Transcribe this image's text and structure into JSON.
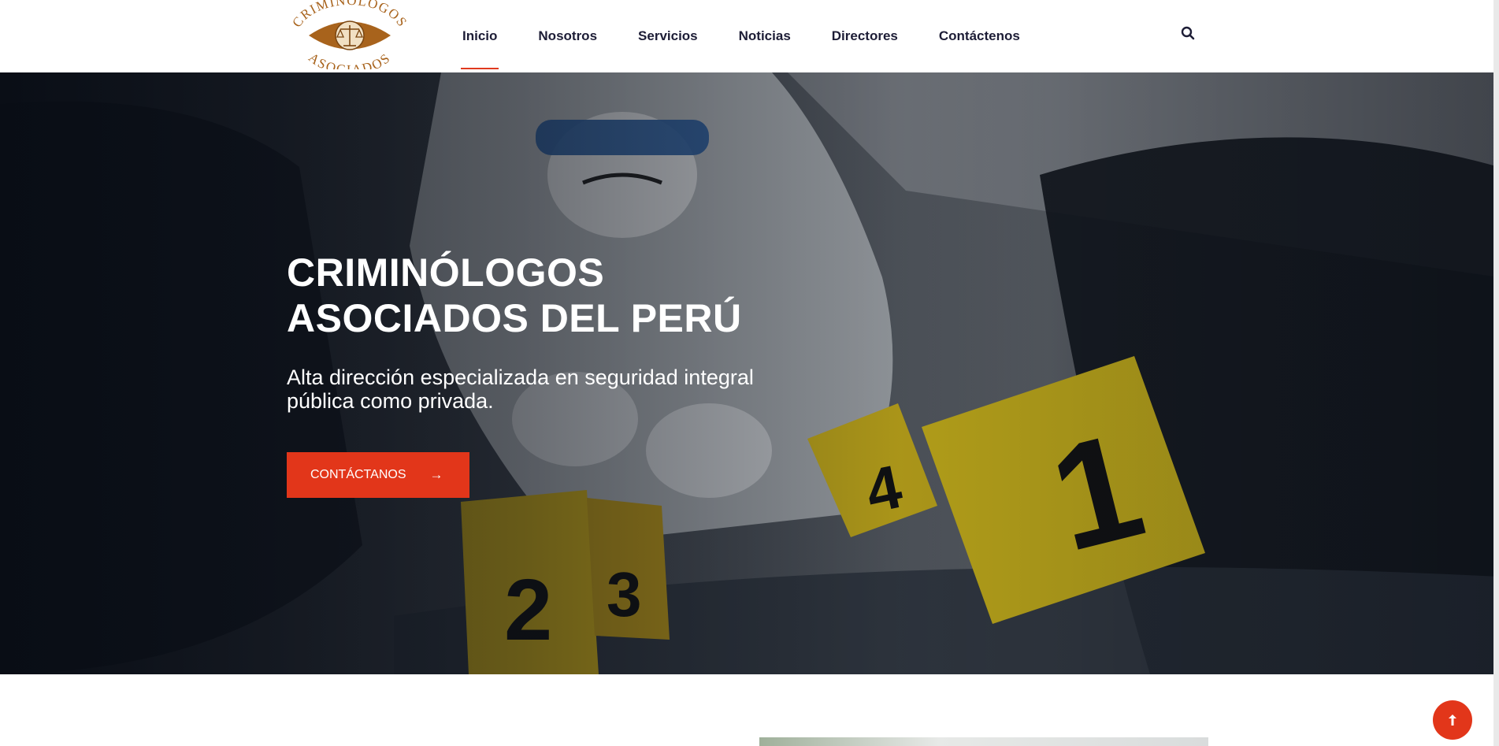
{
  "header": {
    "logo": {
      "top_text": "CRIMINOLOGOS",
      "bottom_text": "ASOCIADOS",
      "color": "#a8631c"
    },
    "nav": [
      {
        "label": "Inicio",
        "active": true
      },
      {
        "label": "Nosotros",
        "active": false
      },
      {
        "label": "Servicios",
        "active": false
      },
      {
        "label": "Noticias",
        "active": false
      },
      {
        "label": "Directores",
        "active": false
      },
      {
        "label": "Contáctenos",
        "active": false
      }
    ],
    "search_icon": "search-icon"
  },
  "hero": {
    "title_line1": "CRIMINÓLOGOS",
    "title_line2": "ASOCIADOS DEL PERÚ",
    "subtitle_line1": "Alta dirección especializada en seguridad integral",
    "subtitle_line2": "pública como privada.",
    "cta_label": "CONTÁCTANOS",
    "cta_icon": "arrow-right-icon",
    "evidence_markers": [
      "1",
      "2",
      "3",
      "4"
    ]
  },
  "back_to_top": {
    "icon": "arrow-up-icon"
  },
  "colors": {
    "accent": "#e2361a",
    "nav_text": "#1d1d36",
    "logo": "#a8631c",
    "marker_yellow": "#e8cc1a"
  }
}
